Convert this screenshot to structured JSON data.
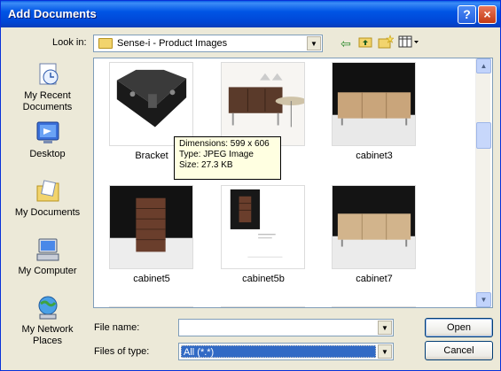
{
  "window": {
    "title": "Add Documents",
    "help_button": "?",
    "close_button": "×"
  },
  "look_in": {
    "label": "Look in:",
    "value": "Sense-i - Product Images"
  },
  "toolbar": [
    "back-icon",
    "up-folder-icon",
    "new-folder-icon",
    "views-menu-icon"
  ],
  "places": [
    {
      "label": "My Recent Documents",
      "icon": "recent-documents-icon"
    },
    {
      "label": "Desktop",
      "icon": "desktop-icon"
    },
    {
      "label": "My Documents",
      "icon": "my-documents-icon"
    },
    {
      "label": "My Computer",
      "icon": "my-computer-icon"
    },
    {
      "label": "My Network Places",
      "icon": "network-places-icon"
    }
  ],
  "files": [
    {
      "name": "Bracket"
    },
    {
      "name": ""
    },
    {
      "name": "cabinet3"
    },
    {
      "name": "cabinet5"
    },
    {
      "name": "cabinet5b"
    },
    {
      "name": "cabinet7"
    }
  ],
  "tooltip": {
    "dimensions": "Dimensions: 599 x 606",
    "type": "Type: JPEG Image",
    "size": "Size: 27.3 KB"
  },
  "file_name": {
    "label": "File name:",
    "value": ""
  },
  "files_of_type": {
    "label": "Files of type:",
    "value": "All (*.*)"
  },
  "buttons": {
    "open": "Open",
    "cancel": "Cancel"
  }
}
